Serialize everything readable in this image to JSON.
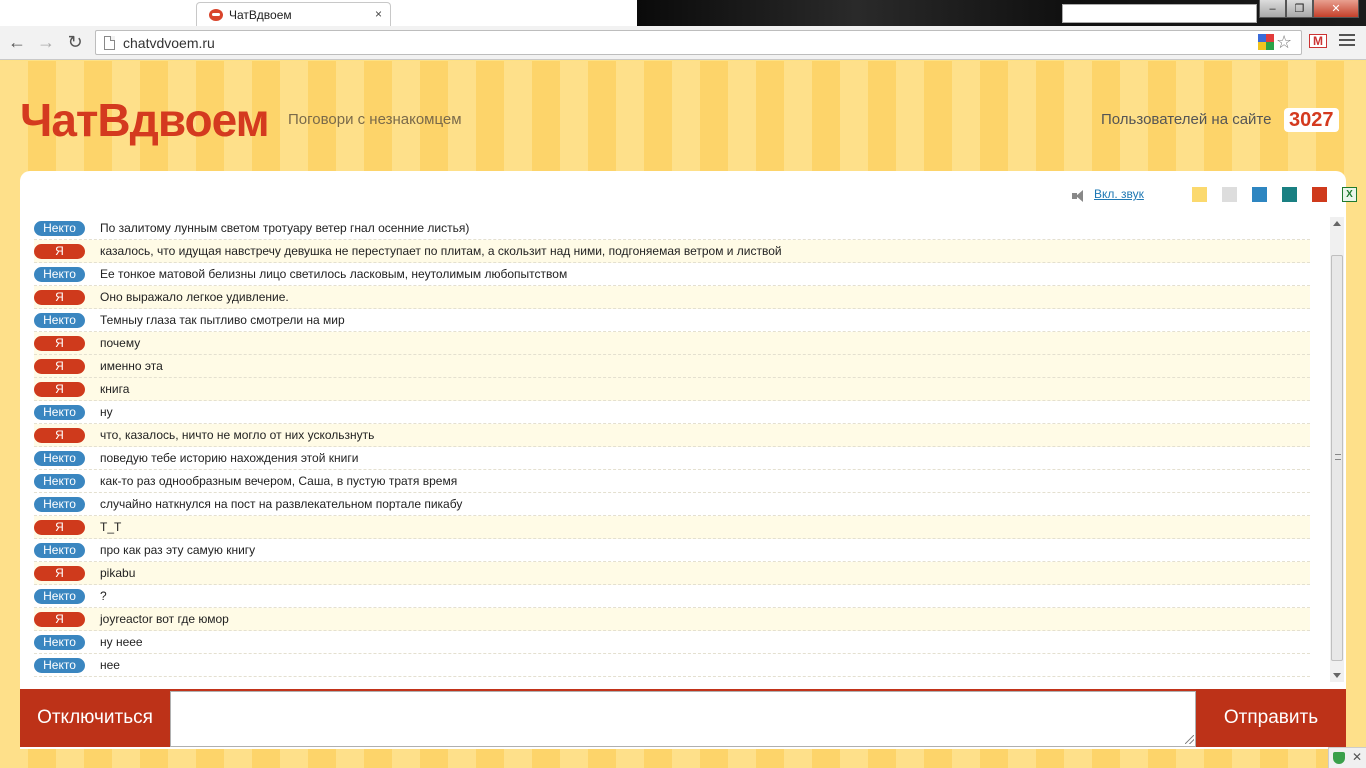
{
  "browser": {
    "tab_title": "ЧатВдвоем",
    "tab_close": "×",
    "url": "chatvdvoem.ru",
    "window_buttons": [
      "‒",
      "❐",
      "✕"
    ],
    "nav": {
      "back": "←",
      "forward": "→",
      "reload": "↻"
    },
    "star": "☆",
    "gmail": "M"
  },
  "header": {
    "logo": "ЧатВдвоем",
    "tagline": "Поговори с незнакомцем",
    "users_label": "Пользователей на сайте",
    "users_count": "3027"
  },
  "tools": {
    "sound_label": "Вкл. звук",
    "swatches": [
      "#fbd96e",
      "#dddddd",
      "#2e86c1",
      "#1a8082",
      "#cf3a1c"
    ],
    "excel": "X"
  },
  "messages": [
    {
      "author": "Некто",
      "role": "stranger",
      "text": "По залитому лунным светом тротуару ветер гнал осенние листья)"
    },
    {
      "author": "Я",
      "role": "me",
      "text": "казалось, что идущая навстречу девушка не переступает по плитам, а скользит над ними, подгоняемая ветром и листвой"
    },
    {
      "author": "Некто",
      "role": "stranger",
      "text": "Ее тонкое матовой белизны лицо светилось ласковым, неутолимым любопытством"
    },
    {
      "author": "Я",
      "role": "me",
      "text": "Оно выражало легкое удивление."
    },
    {
      "author": "Некто",
      "role": "stranger",
      "text": "Темныу глаза так пытливо смотрели на мир"
    },
    {
      "author": "Я",
      "role": "me",
      "text": "почему"
    },
    {
      "author": "Я",
      "role": "me",
      "text": "именно эта"
    },
    {
      "author": "Я",
      "role": "me",
      "text": "книга"
    },
    {
      "author": "Некто",
      "role": "stranger",
      "text": "ну"
    },
    {
      "author": "Я",
      "role": "me",
      "text": "что, казалось, ничто не могло от них ускользнуть"
    },
    {
      "author": "Некто",
      "role": "stranger",
      "text": "поведую тебе историю нахождения этой книги"
    },
    {
      "author": "Некто",
      "role": "stranger",
      "text": "как-то раз однообразным вечером, Саша, в пустую тратя время"
    },
    {
      "author": "Некто",
      "role": "stranger",
      "text": "случайно наткнулся на пост на развлекательном портале пикабу"
    },
    {
      "author": "Я",
      "role": "me",
      "text": "Т_Т"
    },
    {
      "author": "Некто",
      "role": "stranger",
      "text": "про как раз эту самую книгу"
    },
    {
      "author": "Я",
      "role": "me",
      "text": "pikabu"
    },
    {
      "author": "Некто",
      "role": "stranger",
      "text": "?"
    },
    {
      "author": "Я",
      "role": "me",
      "text": "joyreactor вот где юмор"
    },
    {
      "author": "Некто",
      "role": "stranger",
      "text": "ну неее"
    },
    {
      "author": "Некто",
      "role": "stranger",
      "text": "нее"
    }
  ],
  "actions": {
    "disconnect": "Отключиться",
    "send": "Отправить",
    "input_value": ""
  },
  "corner": {
    "close": "✕"
  }
}
